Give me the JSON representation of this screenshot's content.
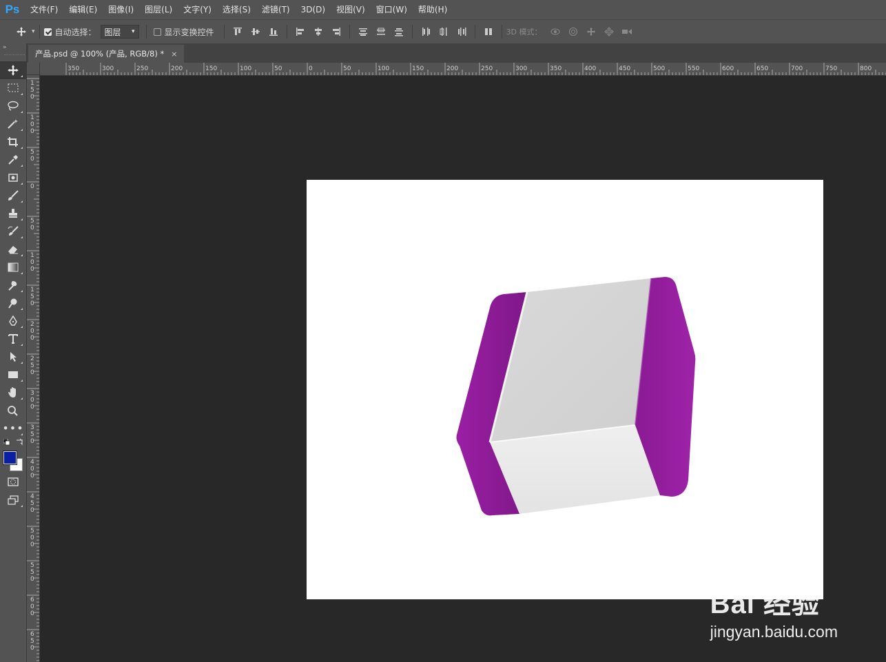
{
  "app": {
    "logo": "Ps",
    "accent": "#31a8ff"
  },
  "menu": [
    {
      "label": "文件(F)"
    },
    {
      "label": "编辑(E)"
    },
    {
      "label": "图像(I)"
    },
    {
      "label": "图层(L)"
    },
    {
      "label": "文字(Y)"
    },
    {
      "label": "选择(S)"
    },
    {
      "label": "滤镜(T)"
    },
    {
      "label": "3D(D)"
    },
    {
      "label": "视图(V)"
    },
    {
      "label": "窗口(W)"
    },
    {
      "label": "帮助(H)"
    }
  ],
  "options": {
    "auto_select_label": "自动选择：",
    "auto_select_checked": true,
    "layer_select_value": "图层",
    "show_transform_label": "显示变换控件",
    "show_transform_checked": false,
    "mode_3d_label": "3D 模式："
  },
  "document": {
    "tab_title": "产品.psd @ 100% (产品, RGB/8) *",
    "close_glyph": "×",
    "ruler_h_labels": [
      "350",
      "300",
      "250",
      "200",
      "150",
      "100",
      "50",
      "0",
      "50",
      "100",
      "150",
      "200",
      "250",
      "300",
      "350",
      "400",
      "450",
      "500",
      "550",
      "600",
      "650",
      "700",
      "750",
      "800"
    ],
    "ruler_v_labels": [
      "150",
      "100",
      "50",
      "0",
      "50",
      "100",
      "150",
      "200",
      "250",
      "300",
      "350",
      "400",
      "450",
      "500",
      "550",
      "600",
      "650"
    ]
  },
  "colors": {
    "foreground": "#0b1fa3",
    "background": "#ffffff",
    "box_purple": "#8e1a96",
    "box_grey": "#d4d4d4"
  },
  "watermark": {
    "brand": "Bai 经验",
    "url": "jingyan.baidu.com"
  }
}
